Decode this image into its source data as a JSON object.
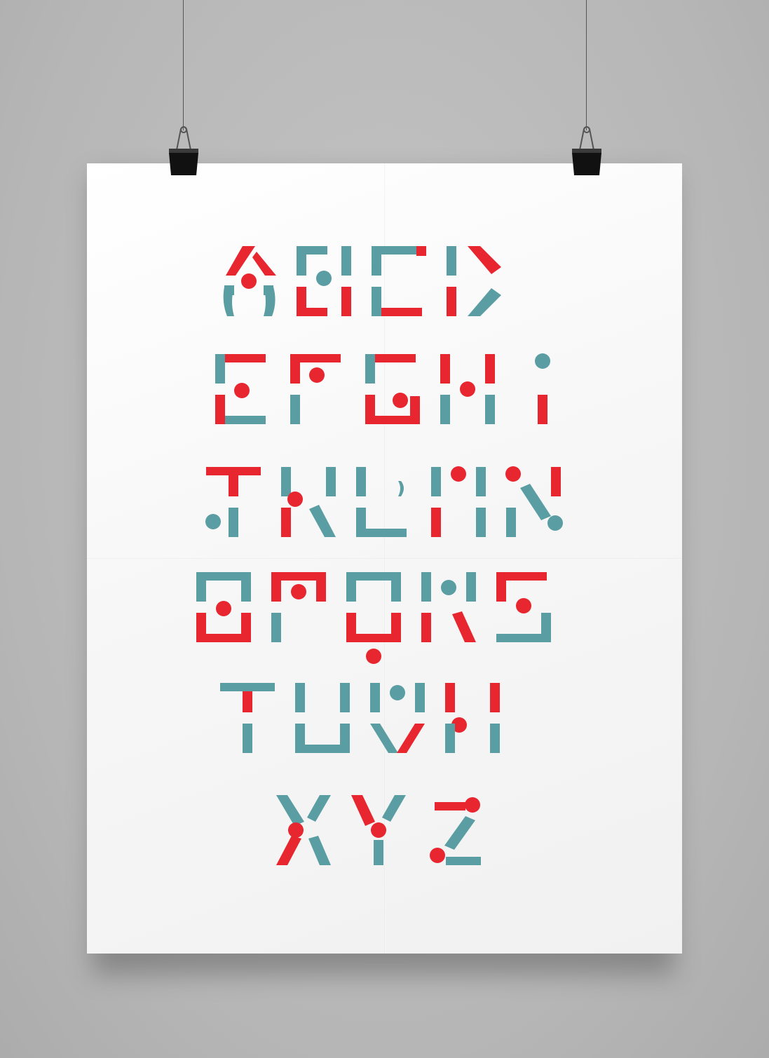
{
  "poster": {
    "rows": [
      {
        "letters": [
          "A",
          "B",
          "C",
          "D"
        ]
      },
      {
        "letters": [
          "E",
          "F",
          "G",
          "H",
          "I"
        ]
      },
      {
        "letters": [
          "J",
          "K",
          "L",
          "M",
          "N"
        ]
      },
      {
        "letters": [
          "O",
          "P",
          "Q",
          "R",
          "S"
        ]
      },
      {
        "letters": [
          "T",
          "U",
          "V",
          "W"
        ]
      },
      {
        "letters": [
          "X",
          "Y",
          "Z"
        ]
      }
    ]
  },
  "colors": {
    "red": "#e8262f",
    "teal": "#5a9ea3",
    "paper": "#ffffff",
    "wall": "#b9b9b9",
    "clip": "#1a1a1a"
  },
  "icons": {
    "left_clip": "binder-clip-icon",
    "right_clip": "binder-clip-icon"
  }
}
